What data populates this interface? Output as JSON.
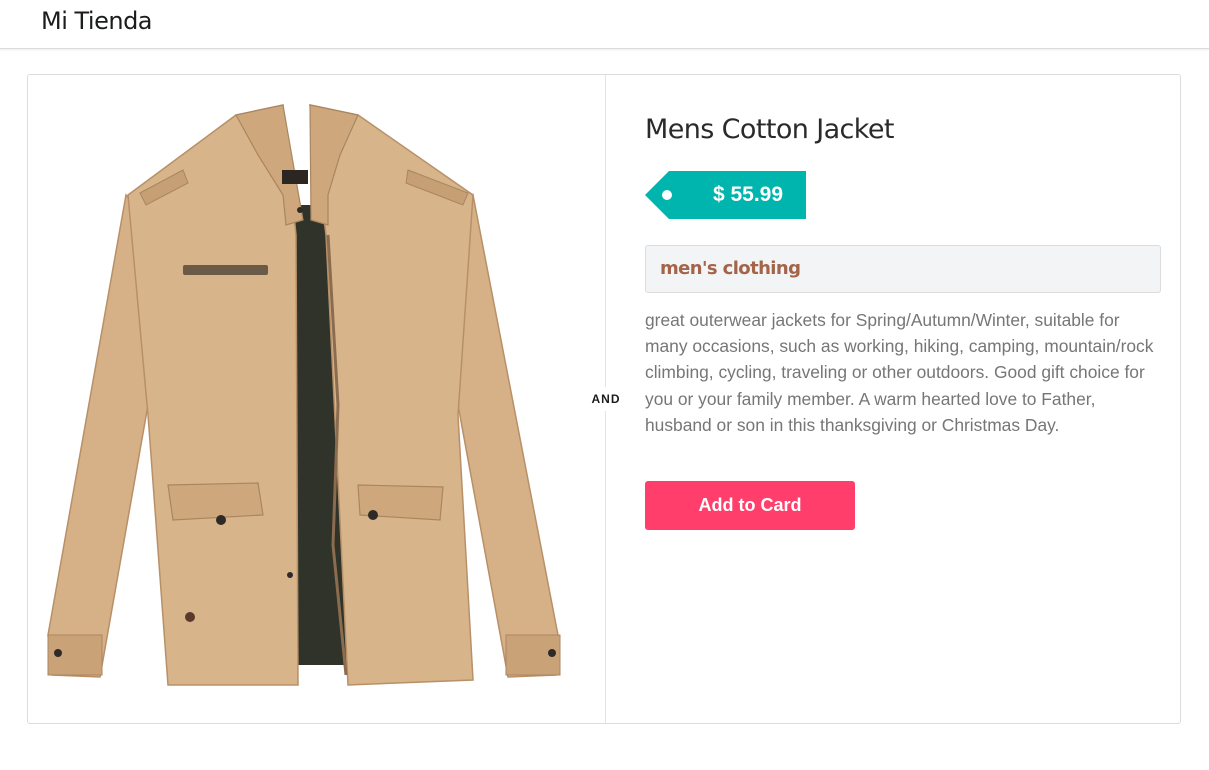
{
  "header": {
    "brand": "Mi Tienda"
  },
  "product": {
    "title": "Mens Cotton Jacket",
    "price": "$ 55.99",
    "category": "men's clothing",
    "description": "great outerwear jackets for Spring/Autumn/Winter, suitable for many occasions, such as working, hiking, camping, mountain/rock climbing, cycling, traveling or other outdoors. Good gift choice for you or your family member. A warm hearted love to Father, husband or son in this thanksgiving or Christmas Day.",
    "image_alt": "jacket-image",
    "divider_label": "AND",
    "add_button_label": "Add to Card"
  },
  "colors": {
    "price_tag": "#00b5ad",
    "add_button": "#ff3e6c",
    "category_text": "#a3644a",
    "jacket": "#d8b48a"
  }
}
